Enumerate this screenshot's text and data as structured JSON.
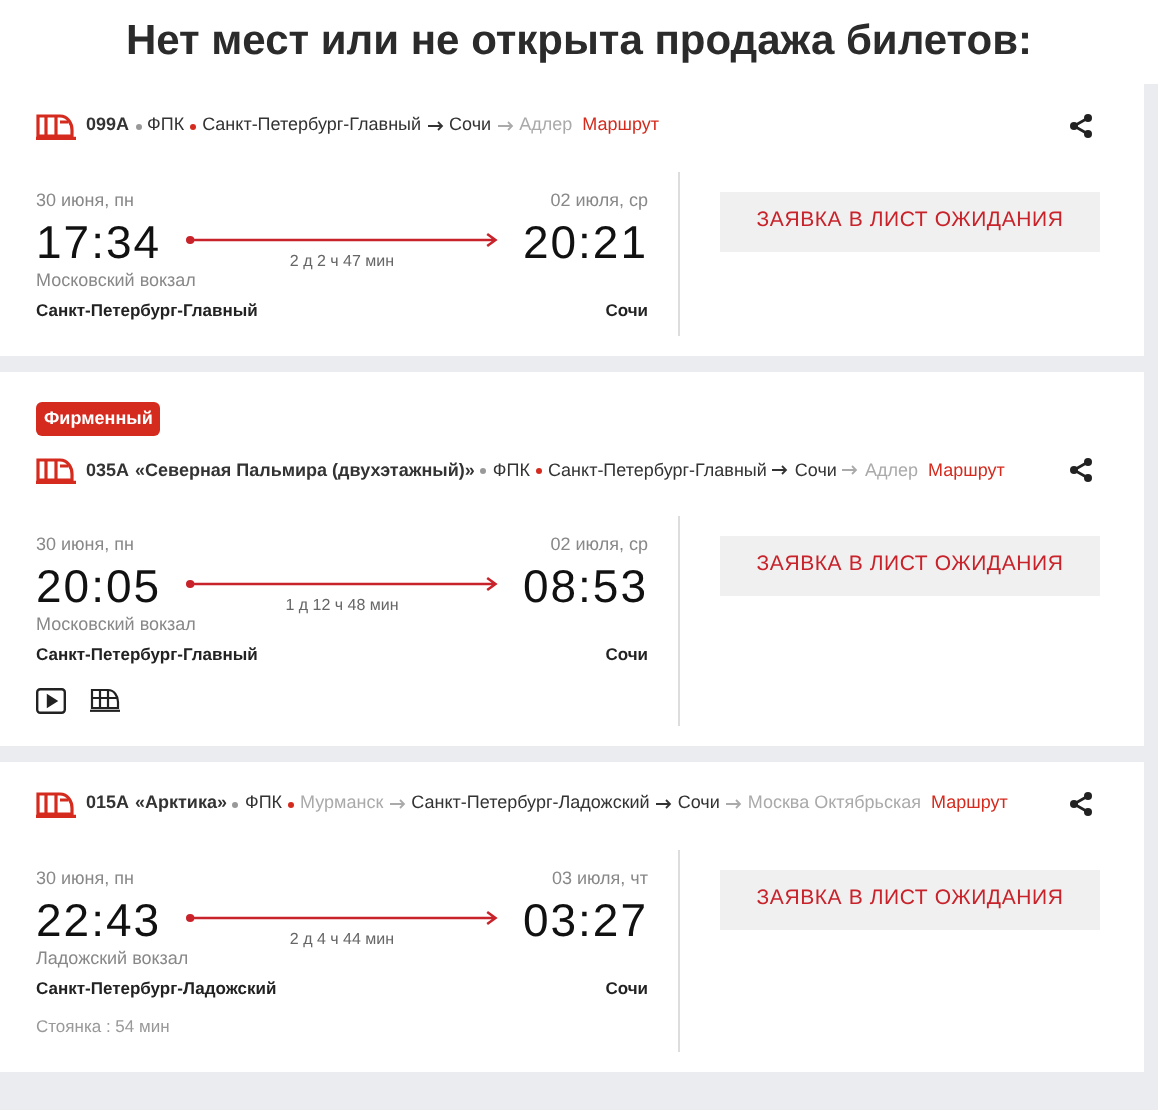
{
  "heading": "Нет мест или не открыта продажа билетов:",
  "trains": [
    {
      "number": "099А",
      "carrier": "ФПК",
      "stops": [
        {
          "name": "Санкт-Петербург-Главный",
          "in_trip": true
        },
        {
          "name": "Сочи",
          "in_trip": true
        },
        {
          "name": "Адлер",
          "in_trip": false
        }
      ],
      "route_link": "Маршрут",
      "dep_date": "30 июня, пн",
      "dep_time": "17:34",
      "duration": "2 д 2 ч 47 мин",
      "arr_date": "02 июля, ср",
      "arr_time": "20:21",
      "dep_station_hint": "Московский вокзал",
      "dep_station": "Санкт-Петербург-Главный",
      "arr_station": "Сочи",
      "button": "ЗАЯВКА В ЛИСТ ОЖИДАНИЯ"
    },
    {
      "badge": "Фирменный",
      "number": "035А",
      "name": "«Северная Пальмира (двухэтажный)»",
      "carrier": "ФПК",
      "stops": [
        {
          "name": "Санкт-Петербург-Главный",
          "in_trip": true
        },
        {
          "name": "Сочи",
          "in_trip": true
        },
        {
          "name": "Адлер",
          "in_trip": false
        }
      ],
      "route_link": "Маршрут",
      "dep_date": "30 июня, пн",
      "dep_time": "20:05",
      "duration": "1 д 12 ч 48 мин",
      "arr_date": "02 июля, ср",
      "arr_time": "08:53",
      "dep_station_hint": "Московский вокзал",
      "dep_station": "Санкт-Петербург-Главный",
      "arr_station": "Сочи",
      "features": [
        {
          "kind": "video"
        },
        {
          "kind": "double-deck"
        }
      ],
      "button": "ЗАЯВКА В ЛИСТ ОЖИДАНИЯ"
    },
    {
      "number": "015А",
      "name": "«Арктика»",
      "carrier": "ФПК",
      "stops": [
        {
          "name": "Мурманск",
          "in_trip": false
        },
        {
          "name": "Санкт-Петербург-Ладожский",
          "in_trip": true
        },
        {
          "name": "Сочи",
          "in_trip": true
        },
        {
          "name": "Москва Октябрьская",
          "in_trip": false
        }
      ],
      "route_link": "Маршрут",
      "dep_date": "30 июня, пн",
      "dep_time": "22:43",
      "duration": "2 д 4 ч 44 мин",
      "arr_date": "03 июля, чт",
      "arr_time": "03:27",
      "dep_station_hint": "Ладожский вокзал",
      "dep_station": "Санкт-Петербург-Ладожский",
      "arr_station": "Сочи",
      "stop_note": "Стоянка : 54 мин",
      "button": "ЗАЯВКА В ЛИСТ ОЖИДАНИЯ"
    }
  ]
}
